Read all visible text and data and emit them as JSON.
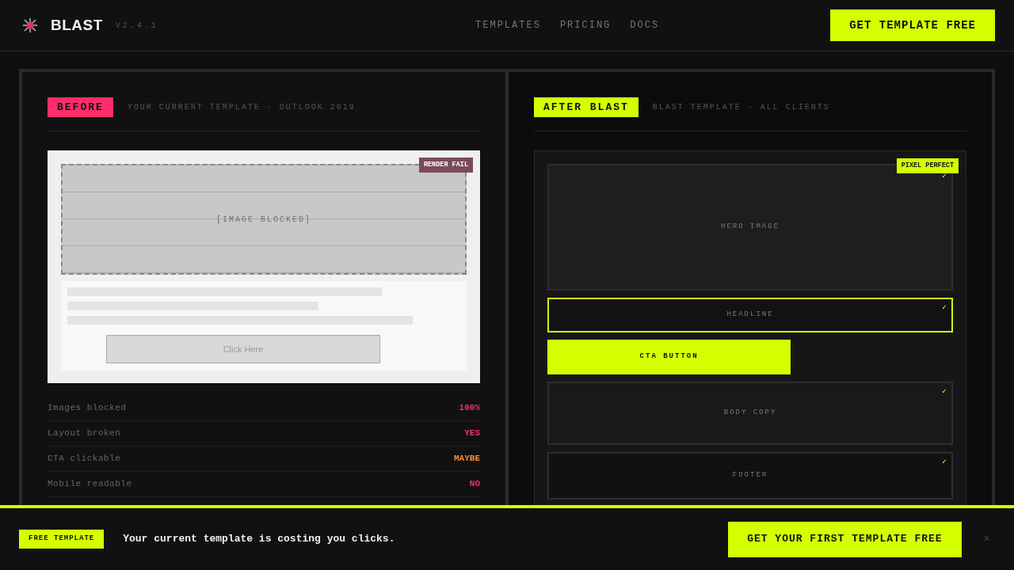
{
  "header": {
    "brand": "BLAST",
    "version": "V2.4.1",
    "nav": [
      {
        "label": "TEMPLATES"
      },
      {
        "label": "PRICING"
      },
      {
        "label": "DOCS"
      }
    ],
    "cta": "GET TEMPLATE FREE"
  },
  "before": {
    "badge": "BEFORE",
    "caption": "YOUR CURRENT TEMPLATE · OUTLOOK 2019",
    "flag": "RENDER FAIL",
    "image_placeholder": "[IMAGE BLOCKED]",
    "button": "Click Here",
    "stats": [
      {
        "label": "Images blocked",
        "value": "100%",
        "color": "#f0306a"
      },
      {
        "label": "Layout broken",
        "value": "YES",
        "color": "#f0306a"
      },
      {
        "label": "CTA clickable",
        "value": "MAYBE",
        "color": "#ff8a3d"
      },
      {
        "label": "Mobile readable",
        "value": "NO",
        "color": "#f0306a"
      }
    ]
  },
  "after": {
    "badge": "AFTER BLAST",
    "caption": "BLAST TEMPLATE · ALL CLIENTS",
    "flag": "PIXEL PERFECT",
    "blocks": [
      {
        "kind": "image",
        "label": "HERO IMAGE",
        "check": "✓"
      },
      {
        "kind": "outlined",
        "label": "HEADLINE",
        "check": "✓"
      },
      {
        "kind": "button",
        "label": "CTA BUTTON"
      },
      {
        "kind": "panel",
        "label": "BODY COPY",
        "check": "✓"
      },
      {
        "kind": "footer",
        "label": "FOOTER",
        "check": "✓"
      }
    ]
  },
  "banner": {
    "tag": "FREE TEMPLATE",
    "message": "Your current template is costing you clicks.",
    "cta": "GET YOUR FIRST TEMPLATE FREE",
    "close": "×"
  }
}
